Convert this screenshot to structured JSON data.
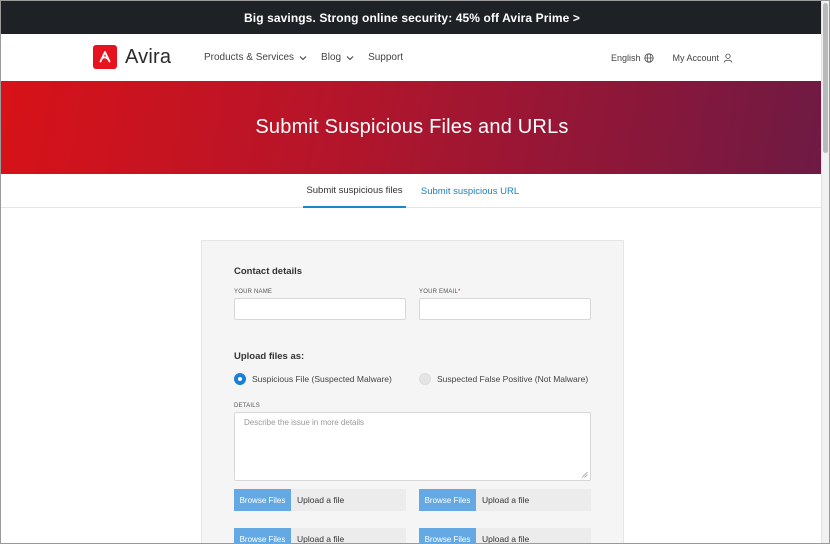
{
  "promo": {
    "text": "Big savings. Strong online security: 45% off Avira Prime >"
  },
  "nav": {
    "logo_text": "Avira",
    "links": [
      {
        "label": "Products & Services",
        "dropdown": true
      },
      {
        "label": "Blog",
        "dropdown": true
      },
      {
        "label": "Support",
        "dropdown": false
      }
    ],
    "language": "English",
    "account": "My Account"
  },
  "hero": {
    "title": "Submit Suspicious Files and URLs"
  },
  "tabs": [
    {
      "label": "Submit suspicious files",
      "active": true
    },
    {
      "label": "Submit suspicious URL",
      "active": false
    }
  ],
  "form": {
    "contact_title": "Contact details",
    "name_label": "YOUR NAME",
    "email_label": "YOUR EMAIL",
    "email_required": "*",
    "name_value": "",
    "email_value": "",
    "upload_title": "Upload files as:",
    "radio_options": [
      {
        "label": "Suspicious File (Suspected Malware)",
        "selected": true
      },
      {
        "label": "Suspected False Positive (Not Malware)",
        "selected": false
      }
    ],
    "details_label": "DETAILS",
    "details_placeholder": "Describe the issue in more details",
    "browse_label": "Browse Files",
    "upload_text": "Upload a file"
  },
  "colors": {
    "accent": "#1a7fd6",
    "brand_red": "#e5141e",
    "promo_bg": "#1e2226"
  }
}
